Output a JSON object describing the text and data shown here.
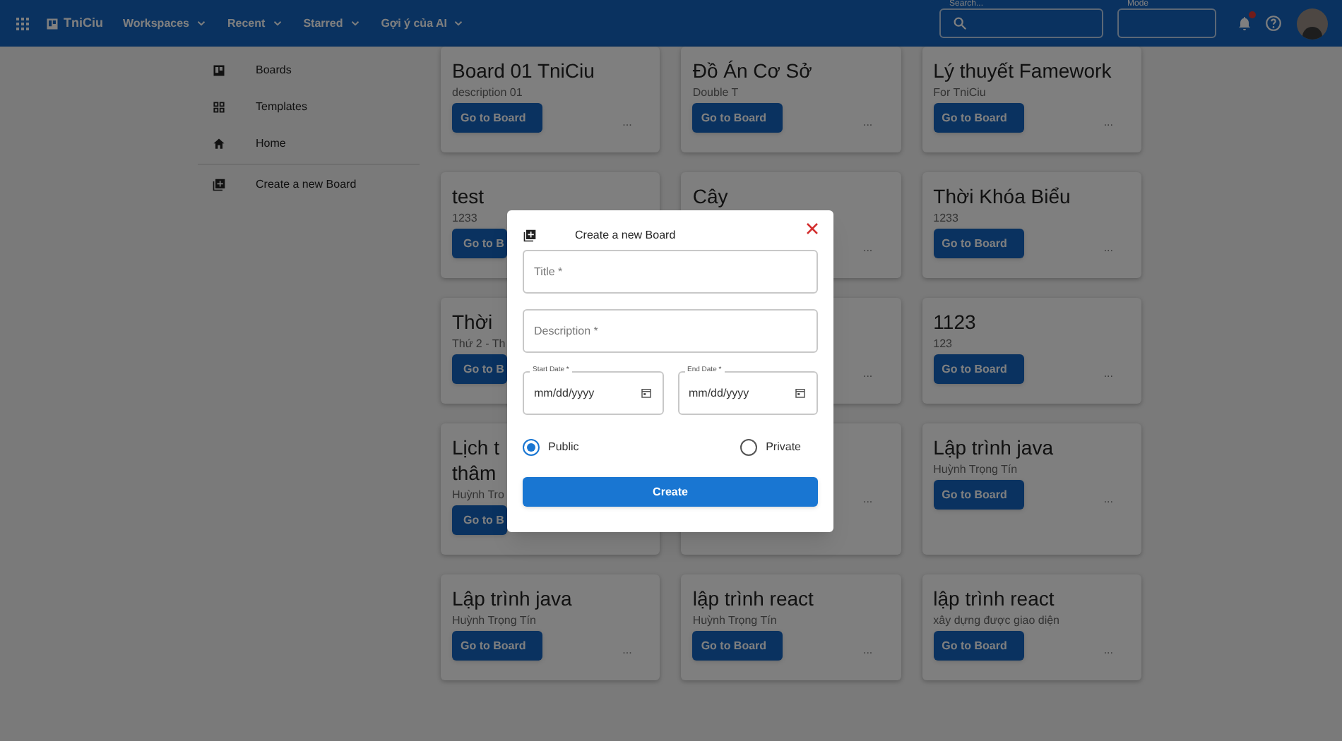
{
  "header": {
    "brand": "TniCiu",
    "menus": [
      {
        "label": "Workspaces"
      },
      {
        "label": "Recent"
      },
      {
        "label": "Starred"
      },
      {
        "label": "Gợi ý của AI"
      }
    ],
    "search": {
      "label": "Search..."
    },
    "mode": {
      "label": "Mode"
    }
  },
  "sidebar": {
    "items": [
      {
        "kind": "boards",
        "label": "Boards"
      },
      {
        "kind": "templates",
        "label": "Templates"
      },
      {
        "kind": "home",
        "label": "Home"
      }
    ],
    "actions": [
      {
        "kind": "create",
        "label": "Create a new Board"
      }
    ]
  },
  "boards": [
    {
      "title": "Board 01 TniCiu",
      "description": "description 01",
      "button": "Go to Board",
      "more": "..."
    },
    {
      "title": "Đồ Án Cơ Sở",
      "description": "Double T",
      "button": "Go to Board",
      "more": "..."
    },
    {
      "title": "Lý thuyết Famework",
      "description": "For TniCiu",
      "button": "Go to Board",
      "more": "..."
    },
    {
      "title": "test",
      "description": "1233",
      "button": "Go to B"
    },
    {
      "title": "Cây",
      "more": "..."
    },
    {
      "title": "Thời Khóa Biểu",
      "description": "1233",
      "button": "Go to Board",
      "more": "..."
    },
    {
      "title": "Thời",
      "description": "Thứ 2 - Th",
      "button": "Go to B"
    },
    {
      "more": "..."
    },
    {
      "title": "1123",
      "description": "123",
      "button": "Go to Board",
      "more": "..."
    },
    {
      "title": "Lịch t\nthâm",
      "description": "Huỳnh Tro",
      "button": "Go to B"
    },
    {
      "more": "..."
    },
    {
      "title": "Lập trình java",
      "description": "Huỳnh Trọng Tín",
      "button": "Go to Board",
      "more": "..."
    },
    {
      "title": "Lập trình java",
      "description": "Huỳnh Trọng Tín",
      "button": "Go to Board",
      "more": "..."
    },
    {
      "title": "lập trình react",
      "description": "Huỳnh Trọng Tín",
      "button": "Go to Board",
      "more": "..."
    },
    {
      "title": "lập trình react",
      "description": "xây dựng được giao diện",
      "button": "Go to Board",
      "more": "..."
    }
  ],
  "dialog": {
    "title": "Create a new Board",
    "fields": [
      {
        "placeholder": "Title *"
      },
      {
        "placeholder": "Description *"
      }
    ],
    "dates": [
      {
        "label": "Start Date *",
        "placeholder": "mm/dd/yyyy"
      },
      {
        "label": "End Date *",
        "placeholder": "mm/dd/yyyy"
      }
    ],
    "visibility": [
      {
        "label": "Public",
        "selected": true
      },
      {
        "label": "Private",
        "selected": false
      }
    ],
    "submit": "Create"
  }
}
